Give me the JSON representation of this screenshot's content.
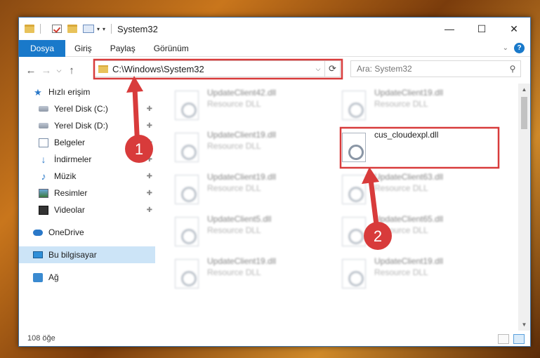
{
  "window": {
    "title": "System32",
    "controls": {
      "minimize": "—",
      "maximize": "☐",
      "close": "✕"
    }
  },
  "ribbon": {
    "tabs": [
      {
        "label": "Dosya",
        "active": true
      },
      {
        "label": "Giriş"
      },
      {
        "label": "Paylaş"
      },
      {
        "label": "Görünüm"
      }
    ],
    "help": "?"
  },
  "address_bar": {
    "path": "C:\\Windows\\System32",
    "refresh_icon": "⟳",
    "dropdown_icon": "⌵"
  },
  "search": {
    "placeholder": "Ara: System32",
    "icon": "⚲"
  },
  "nav": {
    "back": "←",
    "forward": "→",
    "recent": "⌵",
    "up": "↑"
  },
  "sidebar": {
    "items": [
      {
        "label": "Hızlı erişim",
        "icon": "star-icon"
      },
      {
        "label": "Yerel Disk (C:)",
        "icon": "disk-icon",
        "pinned": true
      },
      {
        "label": "Yerel Disk (D:)",
        "icon": "disk-icon",
        "pinned": true
      },
      {
        "label": "Belgeler",
        "icon": "documents-icon",
        "pinned": true
      },
      {
        "label": "İndirmeler",
        "icon": "downloads-icon",
        "pinned": true
      },
      {
        "label": "Müzik",
        "icon": "music-icon",
        "pinned": true
      },
      {
        "label": "Resimler",
        "icon": "pictures-icon",
        "pinned": true
      },
      {
        "label": "Videolar",
        "icon": "videos-icon",
        "pinned": true
      },
      {
        "label": "OneDrive",
        "icon": "onedrive-icon"
      },
      {
        "label": "Bu bilgisayar",
        "icon": "this-pc-icon",
        "selected": true
      },
      {
        "label": "Ağ",
        "icon": "network-icon"
      }
    ],
    "pin_glyph": "📌"
  },
  "files": {
    "left": [
      {
        "name": "UpdateClient42.dll",
        "type": "Resource DLL"
      },
      {
        "name": "UpdateClient19.dll",
        "type": "Resource DLL"
      },
      {
        "name": "UpdateClient19.dll",
        "type": "Resource DLL"
      },
      {
        "name": "UpdateClient5.dll",
        "type": "Resource DLL"
      },
      {
        "name": "UpdateClient19.dll",
        "type": "Resource DLL"
      }
    ],
    "right": [
      {
        "name": "UpdateClient19.dll",
        "type": "Resource DLL"
      },
      {
        "name": "cus_cloudexpl.dll",
        "type": ""
      },
      {
        "name": "UpdateClient63.dll",
        "type": "Resource DLL"
      },
      {
        "name": "UpdateClient65.dll",
        "type": "Resource DLL"
      },
      {
        "name": "UpdateClient19.dll",
        "type": "Resource DLL"
      }
    ]
  },
  "status": {
    "item_count": "108 öğe"
  },
  "annotations": {
    "marker_1": "1",
    "marker_2": "2",
    "color": "#d83b3b"
  }
}
